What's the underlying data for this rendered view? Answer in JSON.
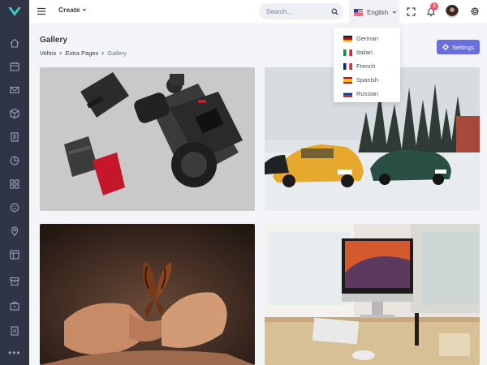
{
  "topbar": {
    "create_label": "Create",
    "search_placeholder": "Search...",
    "language": "English",
    "notification_count": "3"
  },
  "page": {
    "title": "Gallery",
    "breadcrumb": [
      "Veltrix",
      "Extra Pages",
      "Gallery"
    ],
    "settings_label": "Settings"
  },
  "language_menu": [
    {
      "label": "German",
      "flag": "de"
    },
    {
      "label": "Italian",
      "flag": "it"
    },
    {
      "label": "French",
      "flag": "fr"
    },
    {
      "label": "Spanish",
      "flag": "es"
    },
    {
      "label": "Russian",
      "flag": "ru"
    }
  ],
  "colors": {
    "sidebar": "#2f3447",
    "accent": "#6a6fdb",
    "badge": "#f1556c"
  },
  "icons": {
    "sidebar": [
      "home-icon",
      "calendar-icon",
      "mail-icon",
      "box-icon",
      "document-icon",
      "pie-chart-icon",
      "grid-icon",
      "smile-icon",
      "map-pin-icon",
      "layout-icon",
      "archive-icon",
      "briefcase-icon",
      "page-icon",
      "more-icon"
    ]
  }
}
